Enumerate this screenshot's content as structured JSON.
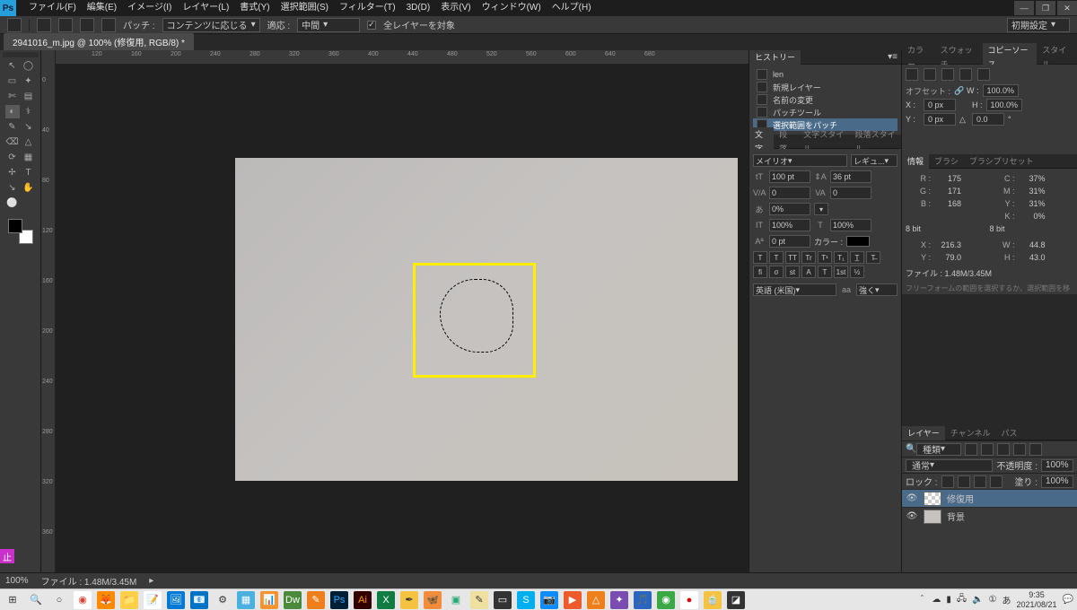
{
  "menubar": {
    "items": [
      "ファイル(F)",
      "編集(E)",
      "イメージ(I)",
      "レイヤー(L)",
      "書式(Y)",
      "選択範囲(S)",
      "フィルター(T)",
      "3D(D)",
      "表示(V)",
      "ウィンドウ(W)",
      "ヘルプ(H)"
    ]
  },
  "optionsbar": {
    "patch_label": "パッチ :",
    "patch_value": "コンテンツに応じる",
    "adapt_label": "適応 :",
    "adapt_value": "中間",
    "all_layers": "全レイヤーを対象",
    "arrangement": "初期設定"
  },
  "document": {
    "tab": "2941016_m.jpg @ 100% (修復用, RGB/8) *"
  },
  "toolbox": {
    "tools": [
      "↖",
      "◯",
      "▭",
      "✦",
      "✄",
      "▤",
      "◐",
      "⚕",
      "✎",
      "↘",
      "⌫",
      "△",
      "⟳",
      "▦",
      "✢",
      "T",
      "↘",
      "✋",
      "⚪"
    ]
  },
  "ruler_h": [
    "120",
    "160",
    "200",
    "240",
    "280",
    "320",
    "360",
    "400",
    "440",
    "480",
    "520",
    "560",
    "600",
    "640",
    "680"
  ],
  "ruler_v": [
    "0",
    "40",
    "80",
    "120",
    "160",
    "200",
    "240",
    "280",
    "320",
    "360"
  ],
  "history": {
    "tab": "ヒストリー",
    "items": [
      {
        "label": "len"
      },
      {
        "label": "新規レイヤー"
      },
      {
        "label": "名前の変更"
      },
      {
        "label": "パッチツール"
      },
      {
        "label": "選択範囲をパッチ",
        "selected": true
      }
    ]
  },
  "character": {
    "tabs": [
      "文字",
      "段落",
      "文字スタイル",
      "段落スタイル"
    ],
    "font": "メイリオ",
    "weight": "レギュ...",
    "size": "100 pt",
    "leading": "36 pt",
    "va": "0",
    "tracking": "0",
    "scale_h": "0%",
    "scale_v": "100%",
    "scale_v2": "100%",
    "baseline": "0 pt",
    "color_label": "カラー :",
    "lang": "英語 (米国)",
    "aa_label": "aa",
    "aa_value": "強く"
  },
  "top_tabs": {
    "labels": [
      "カラー",
      "スウォッチ",
      "コピーソース",
      "スタイル"
    ],
    "active": 2
  },
  "copy_source": {
    "offset_label": "オフセット :",
    "x_label": "X :",
    "x_value": "0 px",
    "y_label": "Y :",
    "y_value": "0 px",
    "w_label": "W :",
    "w_value": "100.0%",
    "h_label": "H :",
    "h_value": "100.0%",
    "angle": "△",
    "angle_value": "0.0",
    "unit": "°"
  },
  "info_tabs": {
    "labels": [
      "情報",
      "ブラシ",
      "ブラシプリセット"
    ],
    "active": 0
  },
  "info": {
    "r_label": "R :",
    "r": "175",
    "c_label": "C :",
    "c": "37%",
    "g_label": "G :",
    "g": "171",
    "m_label": "M :",
    "m": "31%",
    "b_label": "B :",
    "b": "168",
    "y_label": "Y :",
    "y": "31%",
    "k_label": "K :",
    "k": "0%",
    "bit": "8 bit",
    "bit2": "8 bit",
    "x_label": "X :",
    "x": "216.3",
    "w_label": "W :",
    "w": "44.8",
    "yy_label": "Y :",
    "yy": "79.0",
    "h_label": "H :",
    "h": "43.0",
    "file_label": "ファイル : 1.48M/3.45M",
    "hint": "フリーフォームの範囲を選択するか、選択範囲を移動します。Shift、Alt、Ctrl で追加操作。"
  },
  "layers": {
    "tabs": [
      "レイヤー",
      "チャンネル",
      "パス"
    ],
    "kind_label": "種類",
    "mode": "通常",
    "opacity_label": "不透明度 :",
    "opacity": "100%",
    "lock_label": "ロック :",
    "fill_label": "塗り :",
    "fill": "100%",
    "items": [
      {
        "name": "修復用",
        "selected": true,
        "thumb": "trans"
      },
      {
        "name": "背景",
        "selected": false,
        "thumb": "bg"
      }
    ]
  },
  "statusbar": {
    "zoom": "100%",
    "file": "ファイル : 1.48M/3.45M"
  },
  "taskbar": {
    "icons": [
      {
        "glyph": "⊞",
        "bg": "#e6e6e6",
        "color": "#333"
      },
      {
        "glyph": "🔍",
        "bg": "#e6e6e6",
        "color": "#333"
      },
      {
        "glyph": "○",
        "bg": "#e6e6e6",
        "color": "#333"
      },
      {
        "glyph": "◉",
        "bg": "#fff",
        "color": "#db4437"
      },
      {
        "glyph": "🦊",
        "bg": "#ff8a00",
        "color": "#fff"
      },
      {
        "glyph": "📁",
        "bg": "#ffcf48",
        "color": "#333"
      },
      {
        "glyph": "📝",
        "bg": "#fff",
        "color": "#06a"
      },
      {
        "glyph": "🖼",
        "bg": "#0078d4",
        "color": "#fff"
      },
      {
        "glyph": "📧",
        "bg": "#0072c6",
        "color": "#fff"
      },
      {
        "glyph": "⚙",
        "bg": "#e6e6e6",
        "color": "#333"
      },
      {
        "glyph": "▦",
        "bg": "#4ab0e0",
        "color": "#fff"
      },
      {
        "glyph": "📊",
        "bg": "#f59331",
        "color": "#fff"
      },
      {
        "glyph": "Dw",
        "bg": "#4b8a3a",
        "color": "#fff"
      },
      {
        "glyph": "✎",
        "bg": "#ef7f1a",
        "color": "#fff"
      },
      {
        "glyph": "Ps",
        "bg": "#001e36",
        "color": "#31a8ff"
      },
      {
        "glyph": "Ai",
        "bg": "#330000",
        "color": "#ff9a00"
      },
      {
        "glyph": "X",
        "bg": "#107c41",
        "color": "#fff"
      },
      {
        "glyph": "✒",
        "bg": "#f5c242",
        "color": "#333"
      },
      {
        "glyph": "🦋",
        "bg": "#f48c3a",
        "color": "#fff"
      },
      {
        "glyph": "▣",
        "bg": "#e6e6e6",
        "color": "#2a7"
      },
      {
        "glyph": "✎",
        "bg": "#f0e0a0",
        "color": "#333"
      },
      {
        "glyph": "▭",
        "bg": "#333",
        "color": "#fff"
      },
      {
        "glyph": "S",
        "bg": "#00aff0",
        "color": "#fff"
      },
      {
        "glyph": "📷",
        "bg": "#0b8cff",
        "color": "#fff"
      },
      {
        "glyph": "▶",
        "bg": "#ef5a2a",
        "color": "#fff"
      },
      {
        "glyph": "△",
        "bg": "#ef7f1a",
        "color": "#fff"
      },
      {
        "glyph": "✦",
        "bg": "#7a4db0",
        "color": "#fff"
      },
      {
        "glyph": "🎵",
        "bg": "#2a66c0",
        "color": "#fff"
      },
      {
        "glyph": "◉",
        "bg": "#3aa845",
        "color": "#fff"
      },
      {
        "glyph": "●",
        "bg": "#fff",
        "color": "#d00"
      },
      {
        "glyph": "🍵",
        "bg": "#f5c242",
        "color": "#333"
      },
      {
        "glyph": "◪",
        "bg": "#333",
        "color": "#fff"
      }
    ],
    "tray": {
      "caret": "＾",
      "cloud": "☁",
      "batt": "▮",
      "net": "🖧",
      "vol": "🔈",
      "ime1": "①",
      "ime2": "あ",
      "time": "9:35",
      "date": "2021/08/21",
      "notif": "💬"
    }
  }
}
